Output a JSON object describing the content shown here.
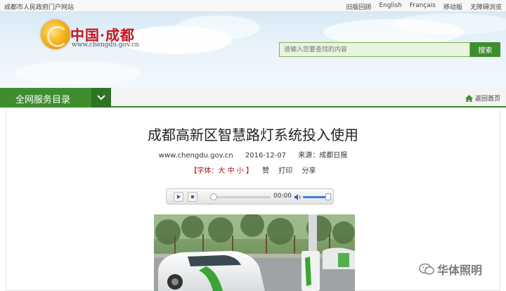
{
  "topbar": {
    "site_label": "成都市人民政府门户网站",
    "links": [
      "旧版回顾",
      "English",
      "Français",
      "移动版",
      "无障碍浏览"
    ]
  },
  "header": {
    "logo_text": "中国·成都",
    "logo_url": "www.chengdu.gov.cn",
    "search_placeholder": "请输入您要查找的内容",
    "search_button": "搜索"
  },
  "nav": {
    "menu_label": "全网服务目录",
    "home_label": "返回首页"
  },
  "article": {
    "title": "成都高新区智慧路灯系统投入使用",
    "source_site": "www.chengdu.gov.cn",
    "date": "2016-12-07",
    "source": "来源：成都日报",
    "font_size_label": "【字体：大 中 小 】",
    "like": "赞",
    "print": "打印",
    "share": "分享"
  },
  "audio_player": {
    "time": "00:00",
    "progress": 0,
    "volume": 0.9
  },
  "watermark": {
    "text": "华体照明"
  },
  "colors": {
    "brand_green": "#3e8e30",
    "logo_red": "#c8161d"
  }
}
